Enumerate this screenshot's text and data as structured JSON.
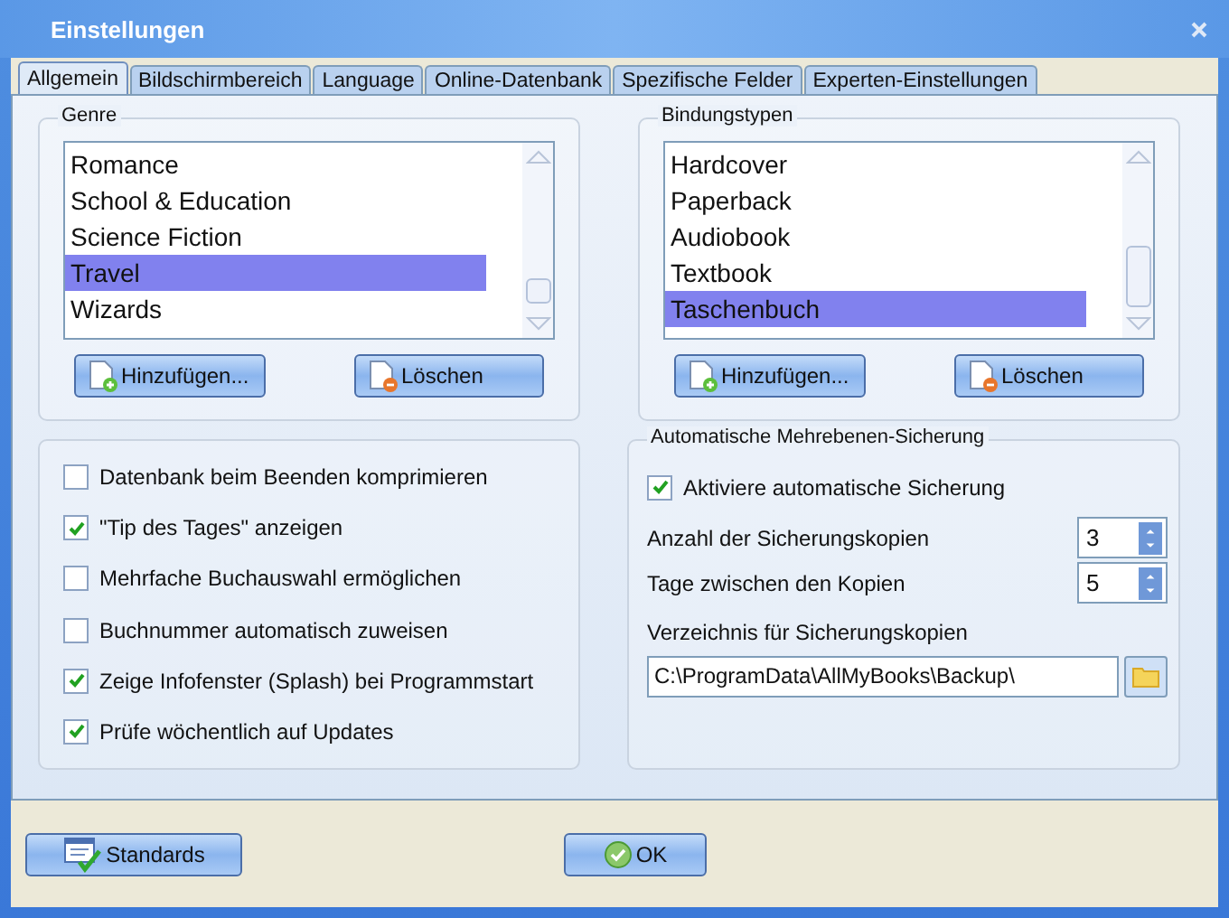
{
  "window": {
    "title": "Einstellungen"
  },
  "tabs": [
    {
      "label": "Allgemein",
      "selected": true
    },
    {
      "label": "Bildschirmbereich",
      "selected": false
    },
    {
      "label": "Language",
      "selected": false
    },
    {
      "label": "Online-Datenbank",
      "selected": false
    },
    {
      "label": "Spezifische Felder",
      "selected": false
    },
    {
      "label": "Experten-Einstellungen",
      "selected": false
    }
  ],
  "genre": {
    "legend": "Genre",
    "items": [
      {
        "label": "Romance",
        "selected": false
      },
      {
        "label": "School & Education",
        "selected": false
      },
      {
        "label": "Science Fiction",
        "selected": false
      },
      {
        "label": "Travel",
        "selected": true
      },
      {
        "label": "Wizards",
        "selected": false
      }
    ],
    "buttons": [
      "Hinzufügen...",
      "Löschen"
    ]
  },
  "bindings": {
    "legend": "Bindungstypen",
    "items": [
      {
        "label": "Hardcover",
        "selected": false
      },
      {
        "label": "Paperback",
        "selected": false
      },
      {
        "label": "Audiobook",
        "selected": false
      },
      {
        "label": "Textbook",
        "selected": false
      },
      {
        "label": "Taschenbuch",
        "selected": true
      }
    ],
    "buttons": [
      "Hinzufügen...",
      "Löschen"
    ]
  },
  "options": [
    {
      "label": "Datenbank beim Beenden komprimieren",
      "checked": false
    },
    {
      "label": "\"Tip des Tages\" anzeigen",
      "checked": true
    },
    {
      "label": "Mehrfache Buchauswahl ermöglichen",
      "checked": false
    },
    {
      "label": "Buchnummer automatisch zuweisen",
      "checked": false
    },
    {
      "label": "Zeige Infofenster (Splash) bei Programmstart",
      "checked": true
    },
    {
      "label": "Prüfe wöchentlich auf Updates",
      "checked": true
    }
  ],
  "backup": {
    "legend": "Automatische Mehrebenen-Sicherung",
    "enable": {
      "label": "Aktiviere automatische Sicherung",
      "checked": true
    },
    "spinners": [
      {
        "label": "Anzahl der Sicherungskopien",
        "value": "3"
      },
      {
        "label": "Tage zwischen den Kopien",
        "value": "5"
      }
    ],
    "folder_label": "Verzeichnis für Sicherungskopien",
    "folder_value": "C:\\ProgramData\\AllMyBooks\\Backup\\"
  },
  "footer": {
    "defaults_button": "Standards",
    "ok_button": "OK"
  }
}
